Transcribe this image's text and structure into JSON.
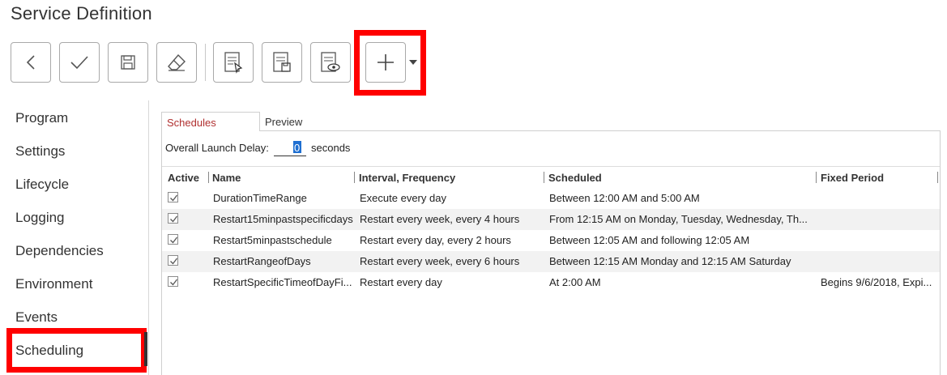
{
  "window": {
    "title": "Service Definition"
  },
  "toolbar": {
    "buttons": [
      {
        "name": "back",
        "icon": "chevron-left-icon"
      },
      {
        "name": "apply",
        "icon": "checkmark-icon"
      },
      {
        "name": "save",
        "icon": "floppy-disk-icon"
      },
      {
        "name": "clear",
        "icon": "eraser-icon"
      },
      {
        "name": "document-pointer",
        "icon": "document-pointer-icon"
      },
      {
        "name": "document-save",
        "icon": "document-save-icon"
      },
      {
        "name": "document-preview",
        "icon": "document-eye-icon"
      },
      {
        "name": "add",
        "icon": "plus-icon"
      }
    ]
  },
  "sidebar": {
    "items": [
      {
        "label": "Program"
      },
      {
        "label": "Settings"
      },
      {
        "label": "Lifecycle"
      },
      {
        "label": "Logging"
      },
      {
        "label": "Dependencies"
      },
      {
        "label": "Environment"
      },
      {
        "label": "Events"
      },
      {
        "label": "Scheduling",
        "selected": true
      }
    ]
  },
  "tabs": [
    {
      "label": "Schedules",
      "active": true
    },
    {
      "label": "Preview",
      "active": false
    }
  ],
  "delay": {
    "label": "Overall Launch Delay:",
    "value": "0",
    "unit": "seconds"
  },
  "grid": {
    "columns": [
      "Active",
      "Name",
      "Interval, Frequency",
      "Scheduled",
      "Fixed Period"
    ],
    "rows": [
      {
        "active": true,
        "name": "DurationTimeRange",
        "interval": "Execute every day",
        "scheduled": "Between 12:00 AM and 5:00 AM",
        "fixed": ""
      },
      {
        "active": true,
        "name": "Restart15minpastspecificdays",
        "interval": "Restart every week, every 4 hours",
        "scheduled": "From 12:15 AM on Monday, Tuesday, Wednesday, Th...",
        "fixed": ""
      },
      {
        "active": true,
        "name": "Restart5minpastschedule",
        "interval": "Restart every day, every 2 hours",
        "scheduled": "Between 12:05 AM and following 12:05 AM",
        "fixed": ""
      },
      {
        "active": true,
        "name": "RestartRangeofDays",
        "interval": "Restart every week, every 6 hours",
        "scheduled": "Between 12:15 AM Monday and 12:15 AM Saturday",
        "fixed": ""
      },
      {
        "active": true,
        "name": "RestartSpecificTimeofDayFi...",
        "interval": "Restart every day",
        "scheduled": "At 2:00 AM",
        "fixed": "Begins 9/6/2018, Expi..."
      }
    ]
  },
  "colors": {
    "highlight": "#ff0000",
    "active_tab_text": "#b03030",
    "selection": "#1f6fd1"
  }
}
